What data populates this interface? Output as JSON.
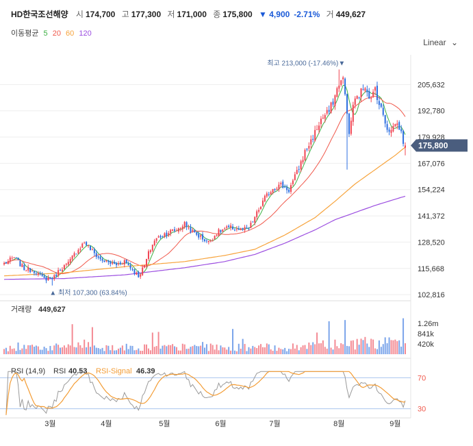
{
  "header": {
    "name": "HD한국조선해양",
    "open_label": "시",
    "open": "174,700",
    "high_label": "고",
    "high": "177,300",
    "low_label": "저",
    "low": "171,000",
    "close_label": "종",
    "close": "175,800",
    "change": "▼ 4,900",
    "change_pct": "-2.71%",
    "volume_label": "거",
    "volume": "449,627"
  },
  "ma_legend": {
    "label": "이동평균",
    "items": [
      {
        "period": "5",
        "color": "#3cb043"
      },
      {
        "period": "20",
        "color": "#f0584b"
      },
      {
        "period": "60",
        "color": "#f7a33b"
      },
      {
        "period": "120",
        "color": "#9b4de0"
      }
    ]
  },
  "scale_toggle": "Linear",
  "colors": {
    "up": "#f04452",
    "down": "#2b6de0",
    "price_tag_bg": "#4a5d7e",
    "grid": "#eeeeee",
    "rsi": "#999999",
    "rsi_signal": "#f39c34"
  },
  "chart_data": [
    {
      "type": "candlestick",
      "y_axis_ticks": [
        205632,
        192780,
        179928,
        167076,
        154224,
        141372,
        128520,
        115668,
        102816
      ],
      "y_axis_tick_labels": [
        "205,632",
        "192,780",
        "179,928",
        "167,076",
        "154,224",
        "141,372",
        "128,520",
        "115,668",
        "102,816"
      ],
      "ylim": [
        100500,
        218500
      ],
      "x_tick_labels": [
        "3월",
        "4월",
        "5월",
        "6월",
        "7월",
        "8월",
        "9월"
      ],
      "current_price": 175800,
      "current_price_label": "175,800",
      "max_annotation": {
        "label": "최고",
        "value": "213,000",
        "pct": "(-17.46%)",
        "arrow": "▼"
      },
      "min_annotation": {
        "label": "최저",
        "value": "107,300",
        "pct": "(63.84%)",
        "arrow": "▲"
      },
      "close_anchors": [
        [
          0,
          118000
        ],
        [
          5,
          121000
        ],
        [
          10,
          115500
        ],
        [
          15,
          114500
        ],
        [
          20,
          110500
        ],
        [
          25,
          111500
        ],
        [
          28,
          115500
        ],
        [
          32,
          118000
        ],
        [
          36,
          124000
        ],
        [
          40,
          128500
        ],
        [
          44,
          124000
        ],
        [
          48,
          120000
        ],
        [
          52,
          118500
        ],
        [
          56,
          117500
        ],
        [
          60,
          119500
        ],
        [
          64,
          115000
        ],
        [
          67,
          112000
        ],
        [
          70,
          117000
        ],
        [
          72,
          123000
        ],
        [
          75,
          129500
        ],
        [
          78,
          131500
        ],
        [
          82,
          133500
        ],
        [
          86,
          134500
        ],
        [
          90,
          137500
        ],
        [
          94,
          133500
        ],
        [
          98,
          131000
        ],
        [
          102,
          128500
        ],
        [
          106,
          133000
        ],
        [
          110,
          135000
        ],
        [
          114,
          135500
        ],
        [
          118,
          134500
        ],
        [
          122,
          135000
        ],
        [
          126,
          142500
        ],
        [
          130,
          150000
        ],
        [
          134,
          155000
        ],
        [
          138,
          156500
        ],
        [
          142,
          154000
        ],
        [
          146,
          162500
        ],
        [
          150,
          172500
        ],
        [
          154,
          180000
        ],
        [
          158,
          188500
        ],
        [
          162,
          192500
        ],
        [
          165,
          200000
        ],
        [
          167,
          206500
        ],
        [
          169,
          208000
        ],
        [
          171,
          193000
        ],
        [
          172,
          180000
        ],
        [
          174,
          196000
        ],
        [
          177,
          200500
        ],
        [
          180,
          205500
        ],
        [
          183,
          198000
        ],
        [
          185,
          204000
        ],
        [
          187,
          196000
        ],
        [
          189,
          191000
        ],
        [
          191,
          184500
        ],
        [
          193,
          183000
        ],
        [
          195,
          187000
        ],
        [
          197,
          185000
        ],
        [
          199,
          178000
        ],
        [
          200,
          175800
        ]
      ],
      "moving_averages": [
        {
          "period": "60",
          "values": [
            [
              0,
              112000
            ],
            [
              30,
              113500
            ],
            [
              60,
              116500
            ],
            [
              90,
              119000
            ],
            [
              110,
              122000
            ],
            [
              125,
              125000
            ],
            [
              140,
              132000
            ],
            [
              155,
              140500
            ],
            [
              165,
              148500
            ],
            [
              175,
              157000
            ],
            [
              185,
              164000
            ],
            [
              195,
              171000
            ],
            [
              200,
              175000
            ]
          ]
        },
        {
          "period": "120",
          "values": [
            [
              0,
              110300
            ],
            [
              30,
              110700
            ],
            [
              60,
              112500
            ],
            [
              90,
              116000
            ],
            [
              110,
              119000
            ],
            [
              125,
              122500
            ],
            [
              140,
              128000
            ],
            [
              155,
              134500
            ],
            [
              165,
              139500
            ],
            [
              175,
              143000
            ],
            [
              185,
              146500
            ],
            [
              195,
              149500
            ],
            [
              200,
              151000
            ]
          ]
        }
      ],
      "volume": {
        "label": "거래량",
        "value": "449,627",
        "axis_labels": [
          "1.26m",
          "841k",
          "420k"
        ],
        "axis_values": [
          1260000,
          841000,
          420000
        ],
        "max": 1600000
      },
      "rsi": {
        "label": "RSI (14,9)",
        "rsi_label": "RSI",
        "rsi_value": "40.53",
        "signal_label": "RSI-Signal",
        "signal_value": "46.39",
        "levels": [
          70,
          30
        ]
      }
    }
  ]
}
